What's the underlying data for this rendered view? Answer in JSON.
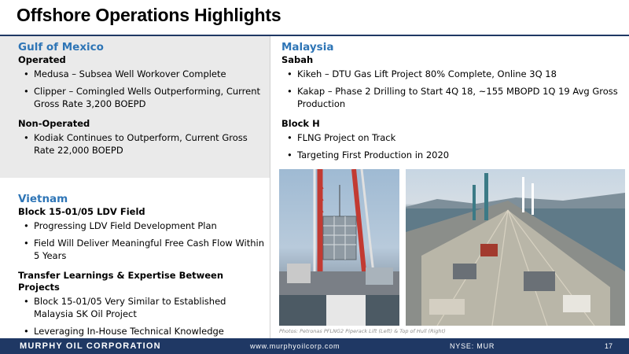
{
  "title": "Offshore Operations Highlights",
  "gulf": {
    "region": "Gulf of Mexico",
    "operated_label": "Operated",
    "operated_items": [
      "Medusa – Subsea Well Workover Complete",
      "Clipper – Comingled Wells Outperforming, Current Gross Rate 3,200 BOEPD"
    ],
    "non_operated_label": "Non-Operated",
    "non_operated_items": [
      "Kodiak Continues to Outperform, Current Gross Rate 22,000 BOEPD"
    ]
  },
  "vietnam": {
    "region": "Vietnam",
    "block_label": "Block 15-01/05 LDV Field",
    "block_items": [
      "Progressing LDV Field Development Plan",
      "Field Will Deliver Meaningful Free Cash Flow Within 5 Years"
    ],
    "transfer_label": "Transfer Learnings & Expertise Between Projects",
    "transfer_items": [
      "Block 15-01/05 Very Similar to Established Malaysia SK Oil Project",
      "Leveraging In-House Technical Knowledge"
    ]
  },
  "malaysia": {
    "region": "Malaysia",
    "sabah_label": "Sabah",
    "sabah_items": [
      "Kikeh – DTU Gas Lift Project 80% Complete, Online 3Q 18",
      "Kakap – Phase 2 Drilling to Start 4Q 18, ~155 MBOPD 1Q 19 Avg Gross Production"
    ],
    "blockh_label": "Block H",
    "blockh_items": [
      "FLNG Project on Track",
      "Targeting First Production in 2020"
    ]
  },
  "photo_caption": "Photos: Petronas PFLNG2 Piperack Lift (Left) & Top of Hull (Right)",
  "footer": {
    "brand": "MURPHY OIL CORPORATION",
    "url": "www.murphyoilcorp.com",
    "ticker": "NYSE: MUR",
    "page": "17"
  },
  "colors": {
    "navy": "#1f3864",
    "region_blue": "#2e75b6",
    "panel_gray": "#eaeaea"
  }
}
